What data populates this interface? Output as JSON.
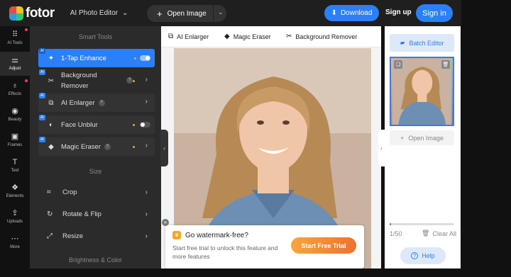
{
  "header": {
    "logo_text": "fotor",
    "editor_select": "AI Photo Editor",
    "open_image": "Open Image",
    "download": "Download",
    "signup": "Sign up",
    "signin": "Sign in"
  },
  "rail": [
    {
      "label": "AI Tools",
      "icon": "grid-icon",
      "glyph": "⠿"
    },
    {
      "label": "Adjust",
      "icon": "sliders-icon",
      "glyph": "⚌"
    },
    {
      "label": "Effects",
      "icon": "flask-icon",
      "glyph": "♁"
    },
    {
      "label": "Beauty",
      "icon": "eye-icon",
      "glyph": "◉"
    },
    {
      "label": "Frames",
      "icon": "frame-icon",
      "glyph": "▣"
    },
    {
      "label": "Text",
      "icon": "text-icon",
      "glyph": "T"
    },
    {
      "label": "Elements",
      "icon": "shapes-icon",
      "glyph": "❖"
    },
    {
      "label": "Uploads",
      "icon": "upload-icon",
      "glyph": "⇪"
    },
    {
      "label": "More",
      "icon": "more-icon",
      "glyph": "⋯"
    }
  ],
  "panel": {
    "smart_tools_heading": "Smart Tools",
    "size_heading": "Size",
    "brightness_heading": "Brightness & Color",
    "ai_badge": "AI",
    "smart_tools": [
      {
        "label": "1-Tap Enhance",
        "icon": "wand-icon"
      },
      {
        "label": "Background",
        "label2": "Remover",
        "icon": "scissors-icon"
      },
      {
        "label": "AI Enlarger",
        "icon": "enlarge-icon"
      },
      {
        "label": "Face Unblur",
        "icon": "face-unblur-icon"
      },
      {
        "label": "Magic Eraser",
        "icon": "eraser-icon"
      }
    ],
    "size_tools": [
      {
        "label": "Crop",
        "icon": "crop-icon"
      },
      {
        "label": "Rotate & Flip",
        "icon": "rotate-icon"
      },
      {
        "label": "Resize",
        "icon": "resize-icon"
      }
    ]
  },
  "canvas_toolbar": [
    {
      "label": "AI Enlarger",
      "icon": "enlarge-icon"
    },
    {
      "label": "Magic Eraser",
      "icon": "eraser-icon"
    },
    {
      "label": "Background Remover",
      "icon": "scissors-icon"
    }
  ],
  "promo": {
    "title": "Go watermark-free?",
    "desc": "Start free trial to unlock this feature and more features",
    "button": "Start Free Trial"
  },
  "right_panel": {
    "batch_editor": "Batch Editor",
    "open_image": "Open Image",
    "count": "1/50",
    "progress": 0.02,
    "clear_all": "Clear All",
    "help": "Help"
  },
  "colors": {
    "accent": "#2b7ff7",
    "promo_orange": "#f5a623",
    "dark_bg": "#1f1f1f"
  }
}
